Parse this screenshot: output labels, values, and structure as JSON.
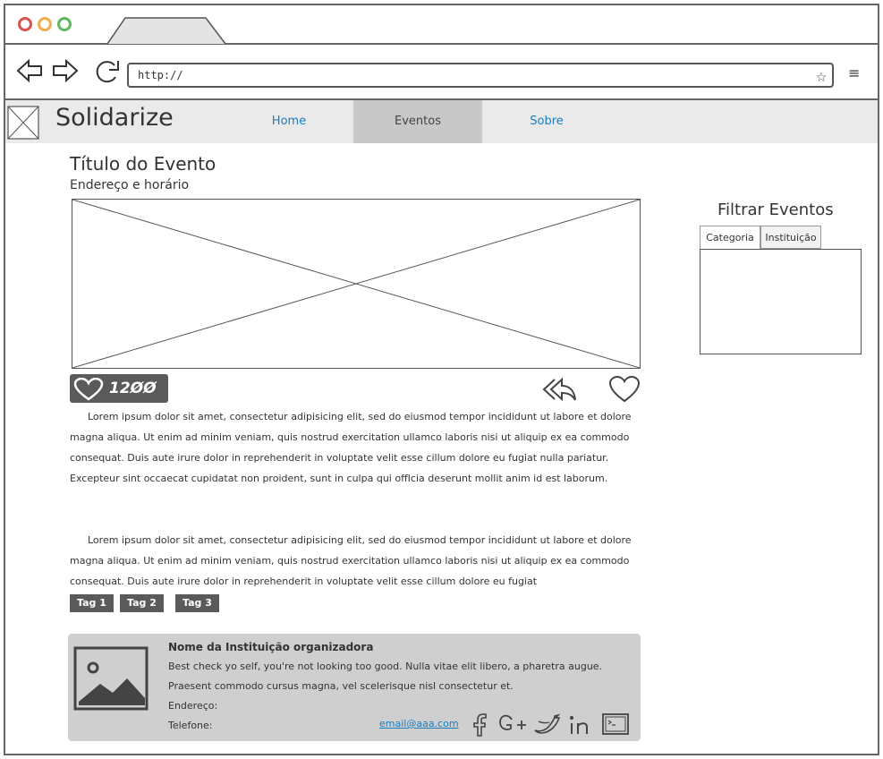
{
  "browser": {
    "url": "http://",
    "buttons": {
      "back": "back-icon",
      "forward": "forward-icon",
      "reload": "reload-icon",
      "bookmark": "star-icon",
      "menu": "hamburger-icon"
    },
    "window_controls": {
      "colors": [
        "#d9534f",
        "#f0ad4e",
        "#5cb85c"
      ]
    },
    "menu_glyph": "≡",
    "star_glyph": "☆"
  },
  "header": {
    "brand": "Solidarize",
    "nav": [
      {
        "label": "Home",
        "active": false
      },
      {
        "label": "Eventos",
        "active": true
      },
      {
        "label": "Sobre",
        "active": false
      }
    ],
    "accent_color": "#1a7fc0"
  },
  "event": {
    "title": "Título do Evento",
    "subtitle": "Endereço e horário",
    "likes": "12ØØ",
    "paragraph1": "Lorem ipsum dolor sit amet, consectetur adipisicing elit, sed do eiusmod tempor incididunt ut labore et dolore magna aliqua. Ut enim ad minim veniam, quis nostrud exercitation ullamco laboris nisi ut aliquip ex ea commodo consequat. Duis aute irure dolor in reprehenderit in voluptate velit esse cillum dolore eu fugiat nulla pariatur. Excepteur sint occaecat cupidatat non proident, sunt in culpa qui offIcia deserunt mollit anim id est laborum.",
    "paragraph2": "Lorem ipsum dolor sit amet, consectetur adipisicing elit, sed do eiusmod tempor incididunt ut labore et dolore magna aliqua. Ut enim ad minim veniam, quis nostrud exercitation ullamco laboris nisi ut aliquip ex ea commodo consequat. Duis aute irure dolor in reprehenderit in voluptate velit esse cillum dolore eu fugiat",
    "tags": [
      "Tag 1",
      "Tag 2",
      "Tag 3"
    ]
  },
  "organizer": {
    "name": "Nome da Instituição organizadora",
    "description": "Best check yo self, you're not looking too good. Nulla vitae elit libero, a pharetra augue. Praesent commodo cursus magna, vel scelerisque nisl consectetur et.",
    "address_label": "Endereço:",
    "phone_label": "Telefone:",
    "email": "email@aaa.com",
    "social": [
      "facebook-icon",
      "google-plus-icon",
      "twitter-icon",
      "linkedin-icon",
      "terminal-icon"
    ]
  },
  "filter": {
    "title": "Filtrar Eventos",
    "tabs": [
      "Categoria",
      "Instituição"
    ]
  }
}
